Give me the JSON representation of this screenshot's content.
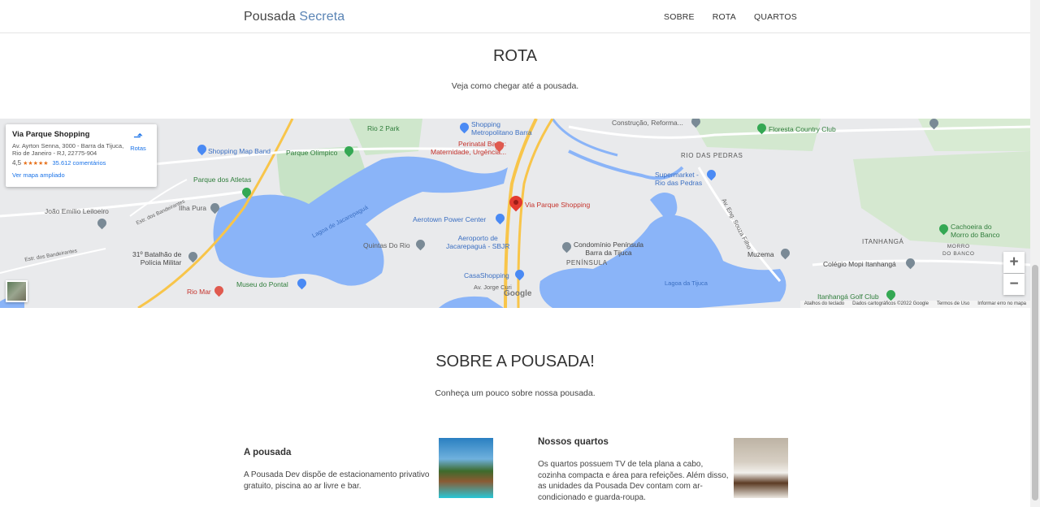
{
  "nav": {
    "brand_part1": "Pousada",
    "brand_part2": "Secreta",
    "links": [
      "SOBRE",
      "ROTA",
      "QUARTOS"
    ]
  },
  "rota": {
    "title": "ROTA",
    "subtitle": "Veja como chegar até a pousada."
  },
  "map": {
    "card": {
      "name": "Via Parque Shopping",
      "address": "Av. Ayrton Senna, 3000 - Barra da Tijuca, Rio de Janeiro - RJ, 22775-904",
      "rating": "4,5",
      "stars": "★★★★★",
      "reviews": "35.612 comentários",
      "larger_map": "Ver mapa ampliado",
      "route_label": "Rotas"
    },
    "pin_label": "Via Parque Shopping",
    "labels": {
      "shopping_metropolitano": "Shopping\nMetropolitano Barra",
      "perinatal": "Perinatal Barra:\nMaternidade, Urgência...",
      "rio2park": "Rio 2 Park",
      "shopping_map_band": "Shopping Map Band",
      "parque_olimpico": "Parque Olímpico",
      "parque_atletas": "Parque dos Atletas",
      "ilha_pura": "Ilha Pura",
      "joao_emilio": "João Emílio Leiloeiro",
      "batalhao": "31º Batalhão de\nPolícia Militar",
      "rio_mar": "Rio Mar",
      "museu_pontal": "Museu do Pontal",
      "lagoa_jacarepagua": "Lagoa de Jacarepaguá",
      "quintas_rio": "Quintas Do Rio",
      "aerotown": "Aerotown Power Center",
      "aeroporto": "Aeroporto de\nJacarepaguá - SBJR",
      "casashopping": "CasaShopping",
      "condominio": "Condomínio Península\nBarra da Tijuca",
      "peninsula": "PENÍNSULA",
      "lagoa_tijuca": "Lagoa da Tijuca",
      "construcao": "Construção, Reforma...",
      "floresta": "Floresta Country Club",
      "rio_das_pedras": "RIO DAS PEDRAS",
      "supermarket": "Supermarket -\nRio das Pedras",
      "cachoeira": "Cachoeira do\nMorro do Banco",
      "itanhanga": "ITANHANGÁ",
      "morro_banco": "MORRO\nDO BANCO",
      "colegio": "Colégio Mopi Itanhangá",
      "muzema": "Muzema",
      "itanhanga_golf": "Itanhangá Golf Club",
      "estr_bandeirantes": "Estr. dos Bandeirantes",
      "estr_bandeirantes_2": "Estr. dos Bandeirantes",
      "av_jorge": "Av. Jorge Curi",
      "engenheiro": "Av. Eng. Souza Filho"
    },
    "google": "Google",
    "attribution": [
      "Atalhos do teclado",
      "Dados cartográficos ©2022 Google",
      "Termos de Uso",
      "Informar erro no mapa"
    ],
    "zoom_in": "+",
    "zoom_out": "−"
  },
  "sobre": {
    "title": "SOBRE A POUSADA!",
    "subtitle": "Conheça um pouco sobre nossa pousada."
  },
  "cards": {
    "pousada": {
      "title": "A pousada",
      "text_line1": "A Pousada Dev dispõe de estacionamento privativo",
      "text_line2": "gratuito, piscina ao ar livre e bar."
    },
    "quartos": {
      "title": "Nossos quartos",
      "text_line1": "Os quartos possuem TV de tela plana a cabo,",
      "text_line2": "cozinha compacta e área para refeições. Além disso,",
      "text_line3": "as unidades da Pousada Dev contam com ar-",
      "text_line4": "condicionado e guarda-roupa."
    }
  },
  "colors": {
    "accent": "#5a84b5",
    "water": "#8ab4f8",
    "park": "#c8e6c9",
    "road_major": "#f8c54a"
  }
}
